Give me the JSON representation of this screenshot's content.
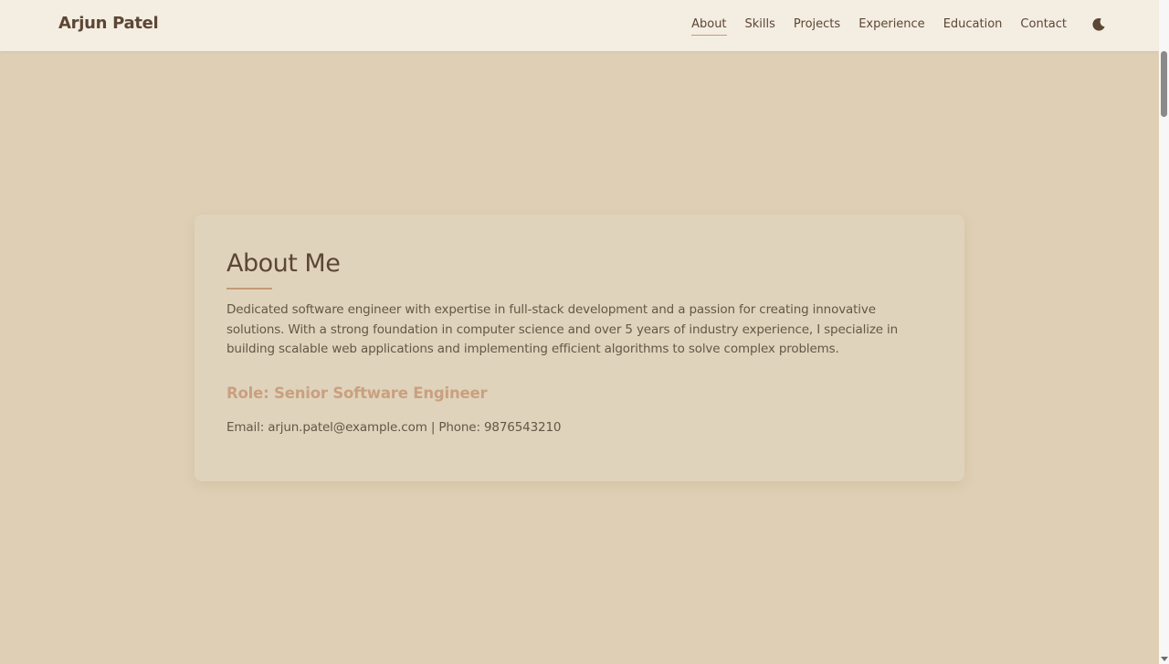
{
  "header": {
    "brand": "Arjun Patel",
    "nav": [
      {
        "label": "About",
        "active": true
      },
      {
        "label": "Skills",
        "active": false
      },
      {
        "label": "Projects",
        "active": false
      },
      {
        "label": "Experience",
        "active": false
      },
      {
        "label": "Education",
        "active": false
      },
      {
        "label": "Contact",
        "active": false
      }
    ],
    "theme_toggle_icon": "moon-icon"
  },
  "about": {
    "title": "About Me",
    "bio": "Dedicated software engineer with expertise in full-stack development and a passion for creating innovative solutions. With a strong foundation in computer science and over 5 years of industry experience, I specialize in building scalable web applications and implementing efficient algorithms to solve complex problems.",
    "role": "Role: Senior Software Engineer",
    "contact": "Email: arjun.patel@example.com | Phone: 9876543210"
  },
  "colors": {
    "page_background": "#dfd0b5",
    "nav_background": "#f4ede2",
    "card_background": "#e0d3bc",
    "accent": "#c59a76",
    "text": "#5c4634"
  }
}
